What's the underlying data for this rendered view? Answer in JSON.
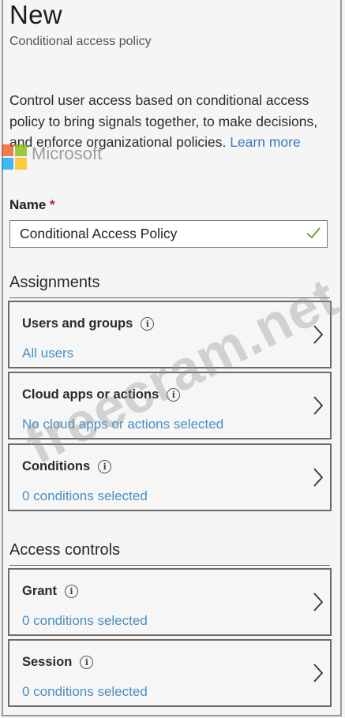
{
  "header": {
    "title": "New",
    "subtitle": "Conditional access policy"
  },
  "description": {
    "text": "Control user access based on conditional access policy to bring signals together, to make decisions, and enforce organizational policies.",
    "link": "Learn more"
  },
  "logo_overlay": {
    "word": "Microsoft"
  },
  "name_field": {
    "label": "Name",
    "required_mark": "*",
    "value": "Conditional Access Policy"
  },
  "assignments": {
    "title": "Assignments",
    "items": [
      {
        "label": "Users and groups",
        "value": "All users"
      },
      {
        "label": "Cloud apps or actions",
        "value": "No cloud apps or actions selected"
      },
      {
        "label": "Conditions",
        "value": "0 conditions selected"
      }
    ]
  },
  "access_controls": {
    "title": "Access controls",
    "items": [
      {
        "label": "Grant",
        "value": "0 conditions selected"
      },
      {
        "label": "Session",
        "value": "0 conditions selected"
      }
    ]
  },
  "watermark": "freecram.net",
  "colors": {
    "link": "#4a8fc1",
    "required": "#b4252b",
    "valid_check": "#5a9e3a"
  }
}
